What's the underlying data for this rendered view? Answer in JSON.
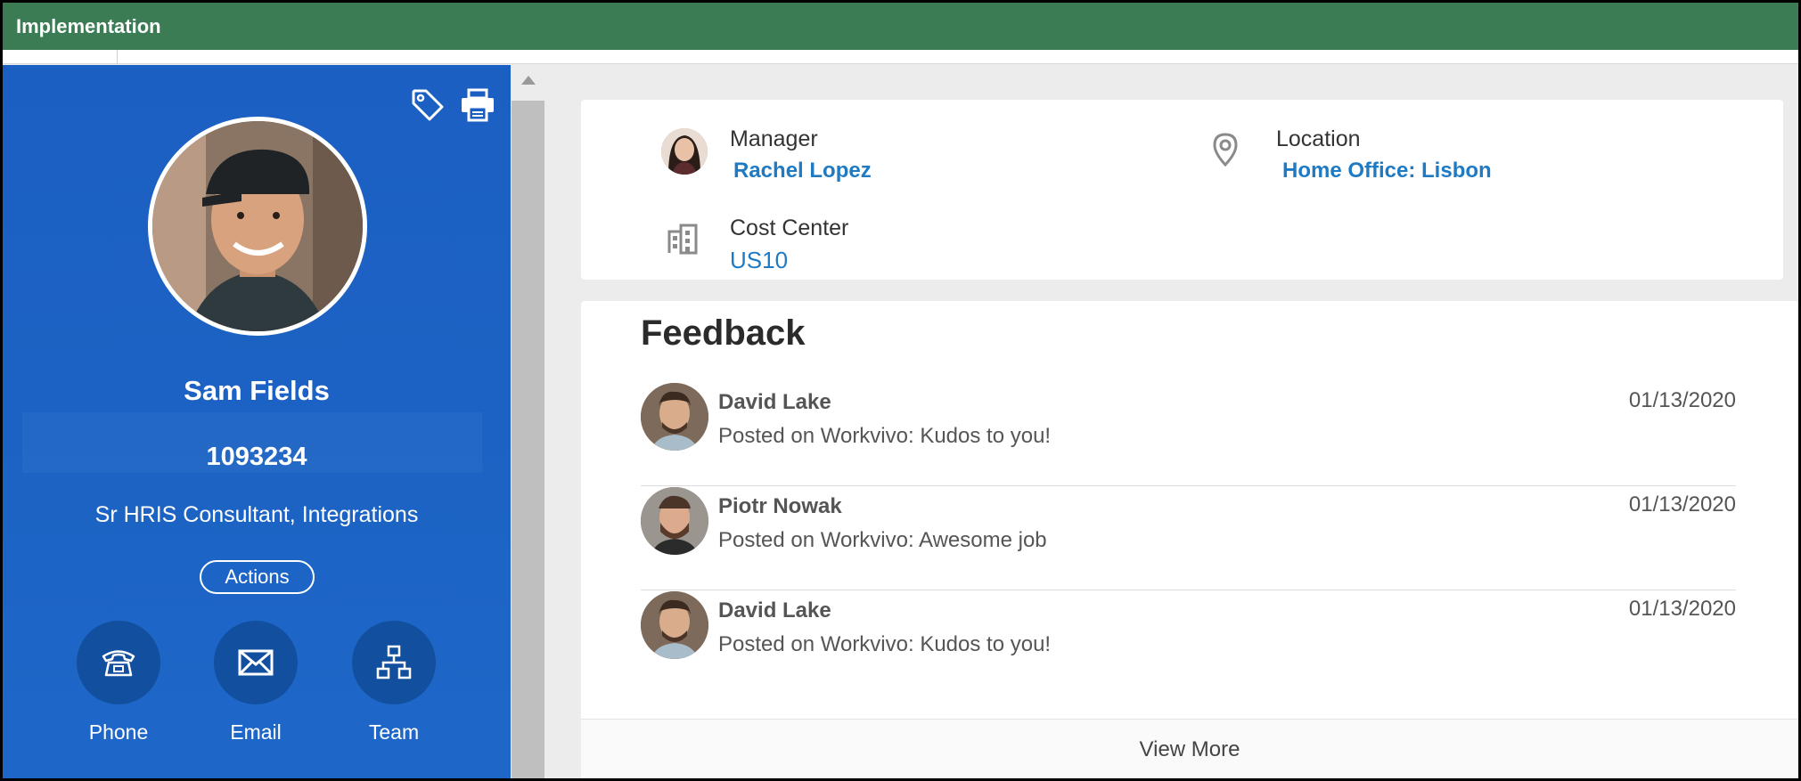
{
  "topbar": {
    "title": "Implementation"
  },
  "profile": {
    "name": "Sam Fields",
    "employee_id": "1093234",
    "job_title": "Sr HRIS Consultant, Integrations",
    "actions_label": "Actions",
    "quick_actions": [
      {
        "label": "Phone",
        "icon": "phone-icon"
      },
      {
        "label": "Email",
        "icon": "email-icon"
      },
      {
        "label": "Team",
        "icon": "org-chart-icon"
      }
    ],
    "tools": [
      "tag-icon",
      "print-icon"
    ]
  },
  "info": {
    "manager_label": "Manager",
    "manager_value": "Rachel Lopez",
    "location_label": "Location",
    "location_value": "Home Office: Lisbon",
    "cost_center_label": "Cost Center",
    "cost_center_value": "US10"
  },
  "feedback": {
    "title": "Feedback",
    "items": [
      {
        "name": "David Lake",
        "message": "Posted on Workvivo: Kudos to you!",
        "date": "01/13/2020"
      },
      {
        "name": "Piotr Nowak",
        "message": "Posted on Workvivo: Awesome job",
        "date": "01/13/2020"
      },
      {
        "name": "David Lake",
        "message": "Posted on Workvivo: Kudos to you!",
        "date": "01/13/2020"
      }
    ],
    "view_more": "View More"
  },
  "colors": {
    "topbar": "#3c7c55",
    "profile_panel": "#1c63c4",
    "link": "#1f7ac4"
  }
}
